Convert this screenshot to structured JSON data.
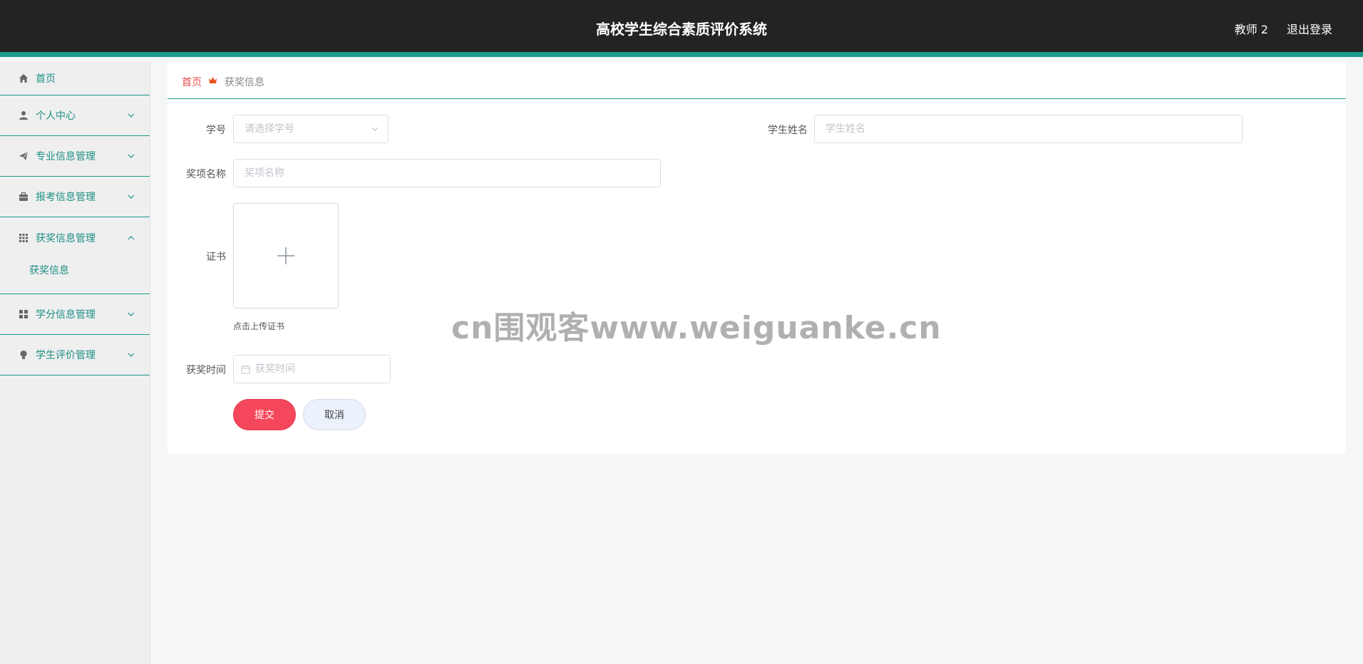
{
  "header": {
    "title": "高校学生综合素质评价系统",
    "user": "教师 2",
    "logout": "退出登录"
  },
  "sidebar": {
    "items": [
      {
        "label": "首页",
        "icon": "home-icon"
      },
      {
        "label": "个人中心",
        "icon": "user-icon"
      },
      {
        "label": "专业信息管理",
        "icon": "paper-plane-icon"
      },
      {
        "label": "报考信息管理",
        "icon": "briefcase-icon"
      },
      {
        "label": "获奖信息管理",
        "icon": "grid-icon",
        "expanded": true,
        "children": [
          {
            "label": "获奖信息"
          }
        ]
      },
      {
        "label": "学分信息管理",
        "icon": "apps-icon"
      },
      {
        "label": "学生评价管理",
        "icon": "lightbulb-icon"
      }
    ]
  },
  "breadcrumb": {
    "home": "首页",
    "current": "获奖信息"
  },
  "form": {
    "student_id_label": "学号",
    "student_id_placeholder": "请选择学号",
    "student_name_label": "学生姓名",
    "student_name_placeholder": "学生姓名",
    "award_name_label": "奖项名称",
    "award_name_placeholder": "奖项名称",
    "certificate_label": "证书",
    "upload_tip": "点击上传证书",
    "award_time_label": "获奖时间",
    "award_time_placeholder": "获奖时间",
    "submit": "提交",
    "cancel": "取消"
  },
  "watermark": "cn围观客www.weiguanke.cn",
  "colors": {
    "header_bg": "#232323",
    "accent": "#1c9b8c",
    "submit": "#f5475b",
    "breadcrumb_home": "#e24d4d"
  }
}
